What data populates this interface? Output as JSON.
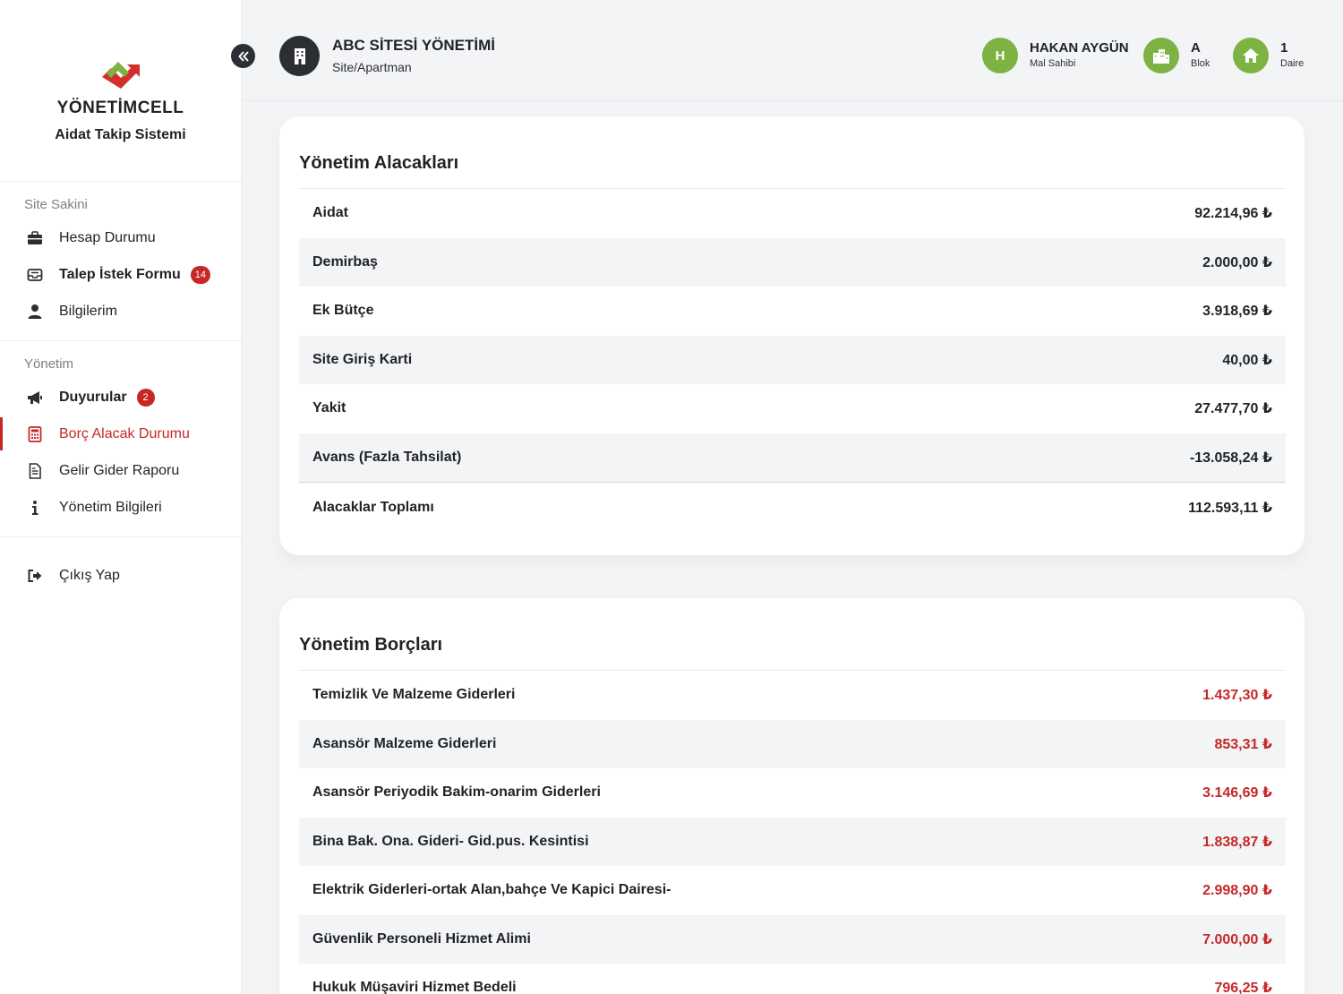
{
  "brand": {
    "logo_part1": "YÖNETİM",
    "logo_part2": "CELL",
    "subtitle": "Aidat Takip Sistemi"
  },
  "sidebar": {
    "sections": [
      {
        "title": "Site Sakini",
        "items": [
          {
            "label": "Hesap Durumu",
            "icon": "briefcase-icon"
          },
          {
            "label": "Talep İstek Formu",
            "icon": "inbox-icon",
            "badge": "14"
          },
          {
            "label": "Bilgilerim",
            "icon": "user-icon"
          }
        ]
      },
      {
        "title": "Yönetim",
        "items": [
          {
            "label": "Duyurular",
            "icon": "megaphone-icon",
            "badge": "2"
          },
          {
            "label": "Borç Alacak Durumu",
            "icon": "calculator-icon",
            "active": true
          },
          {
            "label": "Gelir Gider Raporu",
            "icon": "file-icon"
          },
          {
            "label": "Yönetim Bilgileri",
            "icon": "info-icon"
          }
        ]
      }
    ],
    "logout_label": "Çıkış Yap"
  },
  "header": {
    "site_name": "ABC SİTESİ YÖNETİMİ",
    "site_type": "Site/Apartman",
    "user_initial": "H",
    "user_name": "HAKAN AYGÜN",
    "user_role": "Mal Sahibi",
    "block_value": "A",
    "block_label": "Blok",
    "flat_value": "1",
    "flat_label": "Daire"
  },
  "receivables": {
    "title": "Yönetim Alacakları",
    "rows": [
      {
        "label": "Aidat",
        "value": "92.214,96 ₺"
      },
      {
        "label": "Demirbaş",
        "value": "2.000,00 ₺"
      },
      {
        "label": "Ek Bütçe",
        "value": "3.918,69 ₺"
      },
      {
        "label": "Site Giriş Karti",
        "value": "40,00 ₺"
      },
      {
        "label": "Yakit",
        "value": "27.477,70 ₺"
      },
      {
        "label": "Avans (Fazla Tahsilat)",
        "value": "-13.058,24 ₺"
      }
    ],
    "total_label": "Alacaklar Toplamı",
    "total_value": "112.593,11 ₺"
  },
  "debts": {
    "title": "Yönetim Borçları",
    "rows": [
      {
        "label": "Temizlik Ve Malzeme Giderleri",
        "value": "1.437,30 ₺"
      },
      {
        "label": "Asansör Malzeme Giderleri",
        "value": "853,31 ₺"
      },
      {
        "label": "Asansör Periyodik Bakim-onarim Giderleri",
        "value": "3.146,69 ₺"
      },
      {
        "label": "Bina Bak. Ona. Gideri- Gid.pus. Kesintisi",
        "value": "1.838,87 ₺"
      },
      {
        "label": "Elektrik Giderleri-ortak Alan,bahçe Ve Kapici Dairesi-",
        "value": "2.998,90 ₺"
      },
      {
        "label": "Güvenlik Personeli Hizmet Alimi",
        "value": "7.000,00 ₺"
      },
      {
        "label": "Hukuk Müşaviri Hizmet Bedeli",
        "value": "796,25 ₺"
      }
    ]
  },
  "colors": {
    "accent_red": "#c62828",
    "accent_green": "#7cb342",
    "dark": "#2b2e33"
  }
}
